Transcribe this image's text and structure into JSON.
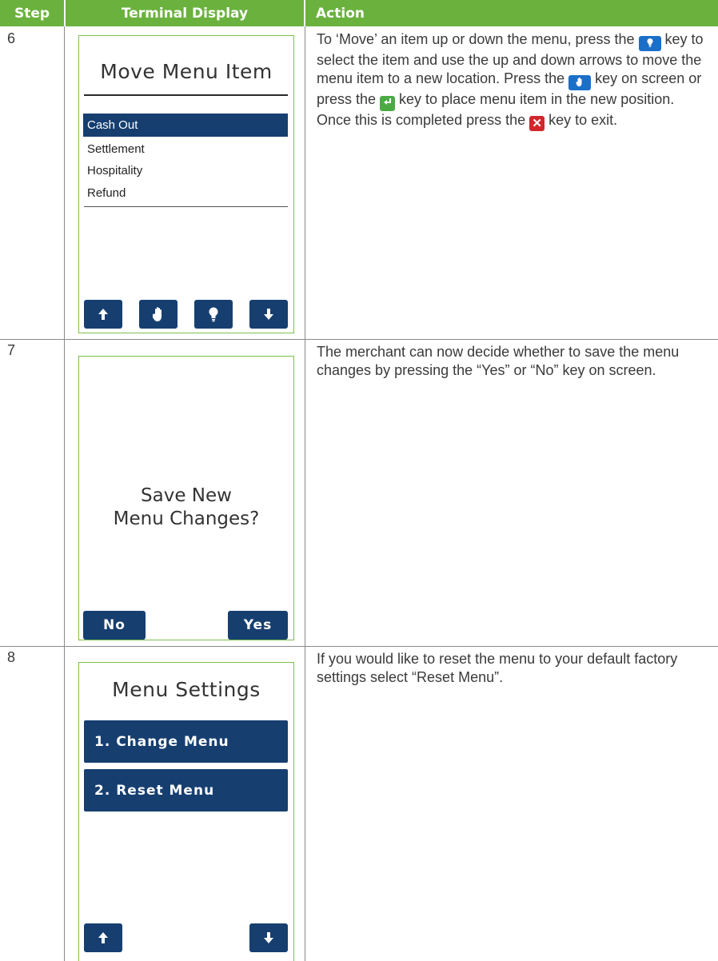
{
  "header": {
    "step": "Step",
    "terminal": "Terminal Display",
    "action": "Action"
  },
  "rows": [
    {
      "step": "6",
      "screen": {
        "title": "Move Menu Item",
        "items": [
          "Cash Out",
          "Settlement",
          "Hospitality",
          "Refund"
        ],
        "selected_item": "Cash Out",
        "buttons": [
          "up-arrow-icon",
          "hand-icon",
          "bulb-icon",
          "down-arrow-icon"
        ]
      },
      "action": {
        "t1": "To ‘Move’ an item up or down the menu, press the ",
        "t2": " key to select the item and use the up and down arrows to move the menu item to a new location. Press the ",
        "t3": " key on screen or press the ",
        "t4": " key to place menu item in the new position. Once this is completed press the ",
        "t5": " key to exit."
      }
    },
    {
      "step": "7",
      "screen": {
        "question_line1": "Save New",
        "question_line2": "Menu Changes?",
        "no_label": "No",
        "yes_label": "Yes"
      },
      "action": {
        "text": "The merchant can now decide whether to save the menu changes by pressing the “Yes” or “No” key on screen."
      }
    },
    {
      "step": "8",
      "screen": {
        "title": "Menu Settings",
        "options": [
          "1. Change Menu",
          "2. Reset Menu"
        ],
        "buttons": [
          "up-arrow-icon",
          "down-arrow-icon"
        ]
      },
      "action": {
        "text": "If you would like to reset the menu to your default factory settings select “Reset Menu”."
      }
    }
  ],
  "colors": {
    "header_green": "#6ab23d",
    "terminal_navy": "#163f70",
    "screen_border": "#7cbf4c",
    "key_blue": "#1c6fc8",
    "key_green": "#4caa44",
    "key_red": "#d2262c"
  }
}
